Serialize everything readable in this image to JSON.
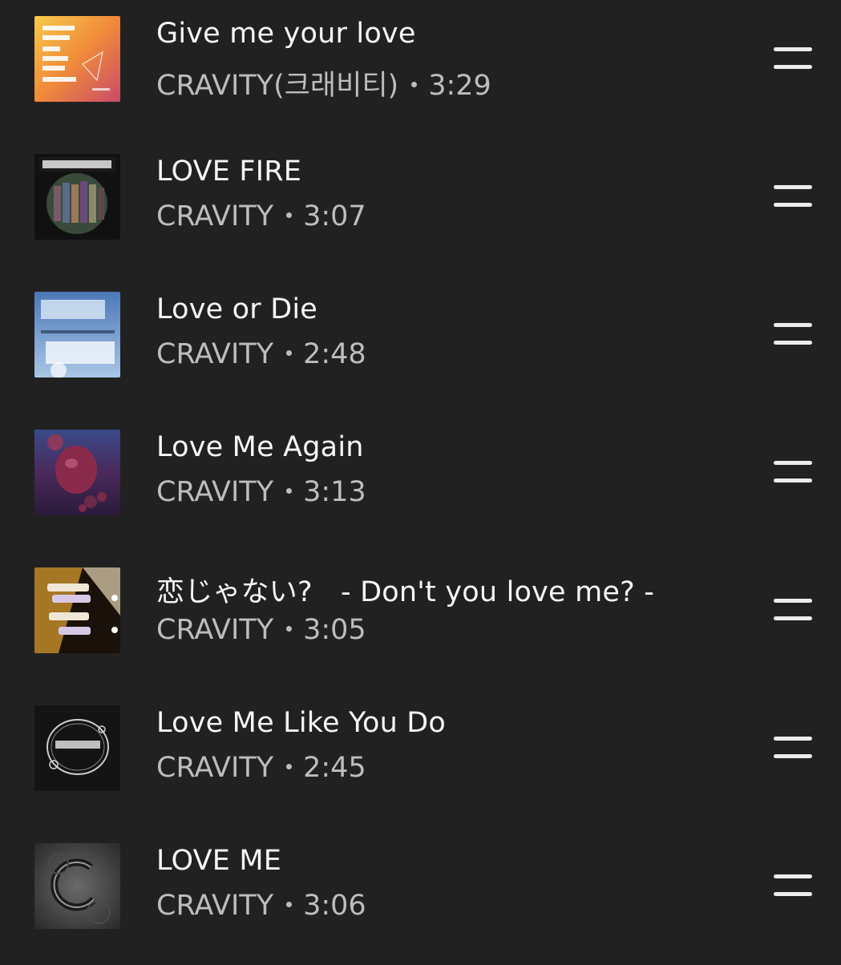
{
  "tracks": [
    {
      "title": "Give me your love",
      "artist": "CRAVITY(크래비티)",
      "duration": "3:29",
      "cover_icon": "album-cover-be-our-voice"
    },
    {
      "title": "LOVE FIRE",
      "artist": "CRAVITY",
      "duration": "3:07",
      "cover_icon": "album-cover-sun-seeker"
    },
    {
      "title": "Love or Die",
      "artist": "CRAVITY",
      "duration": "2:48",
      "cover_icon": "album-cover-evershine"
    },
    {
      "title": "Love Me Again",
      "artist": "CRAVITY",
      "duration": "3:13",
      "cover_icon": "album-cover-purple-spheres"
    },
    {
      "title": "恋じゃない?　- Don't you love me? -",
      "artist": "CRAVITY",
      "duration": "3:05",
      "cover_icon": "album-cover-chat-bubbles"
    },
    {
      "title": "Love Me Like You Do",
      "artist": "CRAVITY",
      "duration": "2:45",
      "cover_icon": "album-cover-dark-ring"
    },
    {
      "title": "LOVE ME",
      "artist": "CRAVITY",
      "duration": "3:06",
      "cover_icon": "album-cover-grey-swirl"
    }
  ],
  "colors": {
    "background": "#212121",
    "title_text": "#f7f7f7",
    "meta_text": "#bdbdbd",
    "handle": "#ececec"
  }
}
